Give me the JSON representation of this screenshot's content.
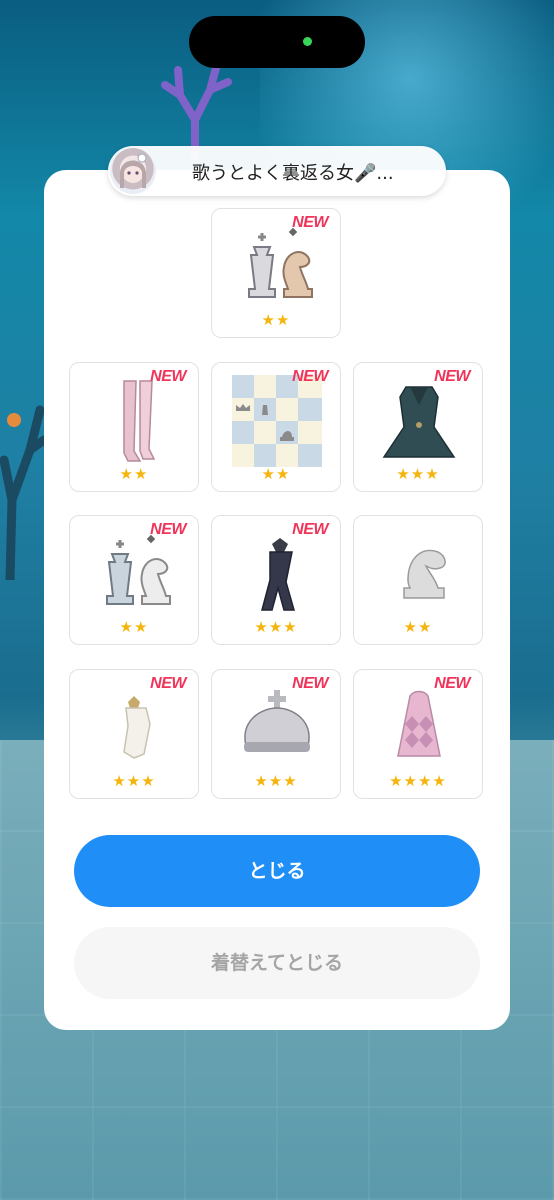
{
  "profile": {
    "name": "歌うとよく裏返る女🎤..."
  },
  "rewards": [
    {
      "id": "chess-kq",
      "badge": "NEW",
      "stars": "★★"
    },
    {
      "id": "pink-boots",
      "badge": "NEW",
      "stars": "★★"
    },
    {
      "id": "chessboard-bg",
      "badge": "NEW",
      "stars": "★★"
    },
    {
      "id": "dark-coat",
      "badge": "NEW",
      "stars": "★★★"
    },
    {
      "id": "chess-kq-2",
      "badge": "NEW",
      "stars": "★★"
    },
    {
      "id": "dark-scarf",
      "badge": "NEW",
      "stars": "★★★"
    },
    {
      "id": "knight",
      "badge": "",
      "stars": "★★"
    },
    {
      "id": "white-hat",
      "badge": "NEW",
      "stars": "★★★"
    },
    {
      "id": "silver-crown",
      "badge": "NEW",
      "stars": "★★★"
    },
    {
      "id": "pink-dress",
      "badge": "NEW",
      "stars": "★★★★"
    }
  ],
  "buttons": {
    "close": "とじる",
    "change_close": "着替えてとじる"
  },
  "colors": {
    "primary": "#1f8ff7",
    "badge": "#f0345a",
    "star": "#f5b50e"
  }
}
